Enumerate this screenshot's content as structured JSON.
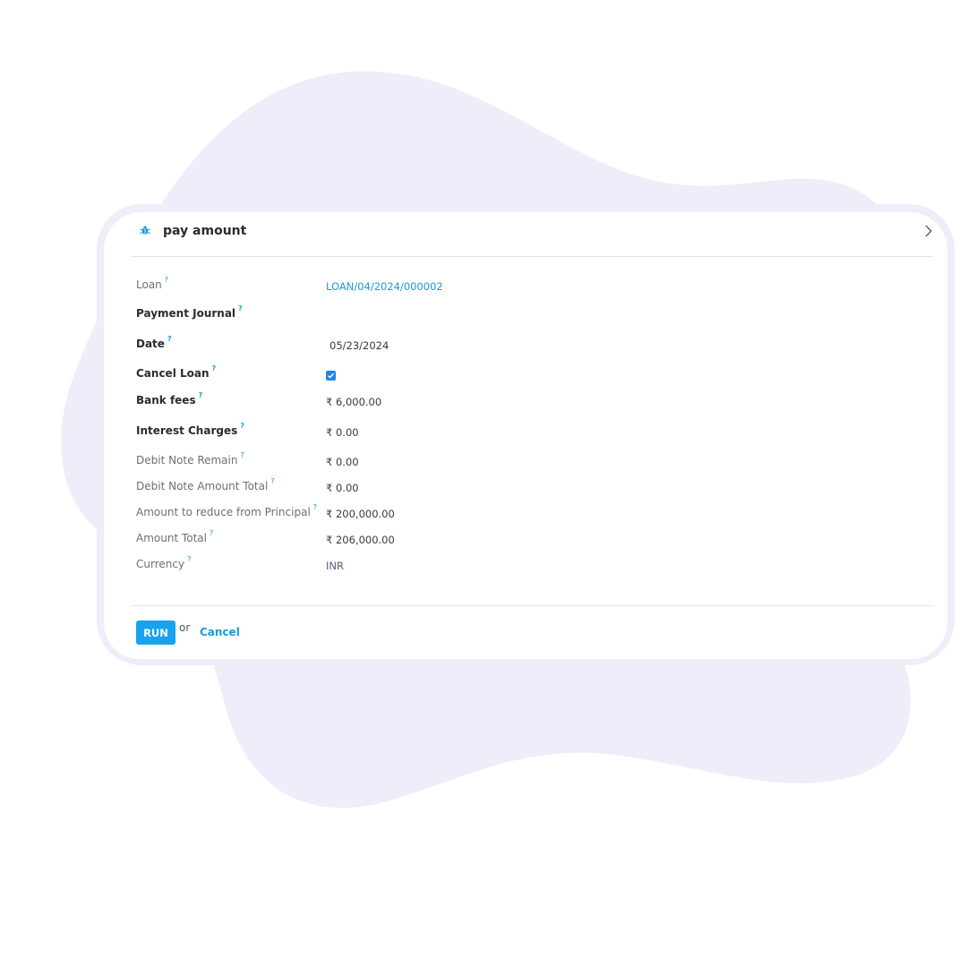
{
  "dialog": {
    "title": "pay amount",
    "header_icon": "bug-icon",
    "close_icon": "chevron-right-icon"
  },
  "help_marker": "?",
  "fields": {
    "loan": {
      "label": "Loan",
      "value": "LOAN/04/2024/000002"
    },
    "payment_journal": {
      "label": "Payment Journal",
      "value": ""
    },
    "date": {
      "label": "Date",
      "value": "05/23/2024"
    },
    "cancel_loan": {
      "label": "Cancel Loan",
      "checked": true
    },
    "bank_fees": {
      "label": "Bank fees",
      "value": "₹ 6,000.00"
    },
    "interest_charges": {
      "label": "Interest Charges",
      "value": "₹ 0.00"
    },
    "debit_note_remain": {
      "label": "Debit Note Remain",
      "value": "₹ 0.00"
    },
    "debit_note_amount_total": {
      "label": "Debit Note Amount Total",
      "value": "₹ 0.00"
    },
    "amount_to_reduce": {
      "label": "Amount to reduce from Principal",
      "value": "₹ 200,000.00"
    },
    "amount_total": {
      "label": "Amount Total",
      "value": "₹ 206,000.00"
    },
    "currency": {
      "label": "Currency",
      "value": "INR"
    }
  },
  "footer": {
    "run_label": "RUN",
    "or_label": "or",
    "cancel_label": "Cancel"
  },
  "colors": {
    "accent": "#17a3ee",
    "link": "#1a9bd7",
    "blob": "#eeedf9"
  }
}
